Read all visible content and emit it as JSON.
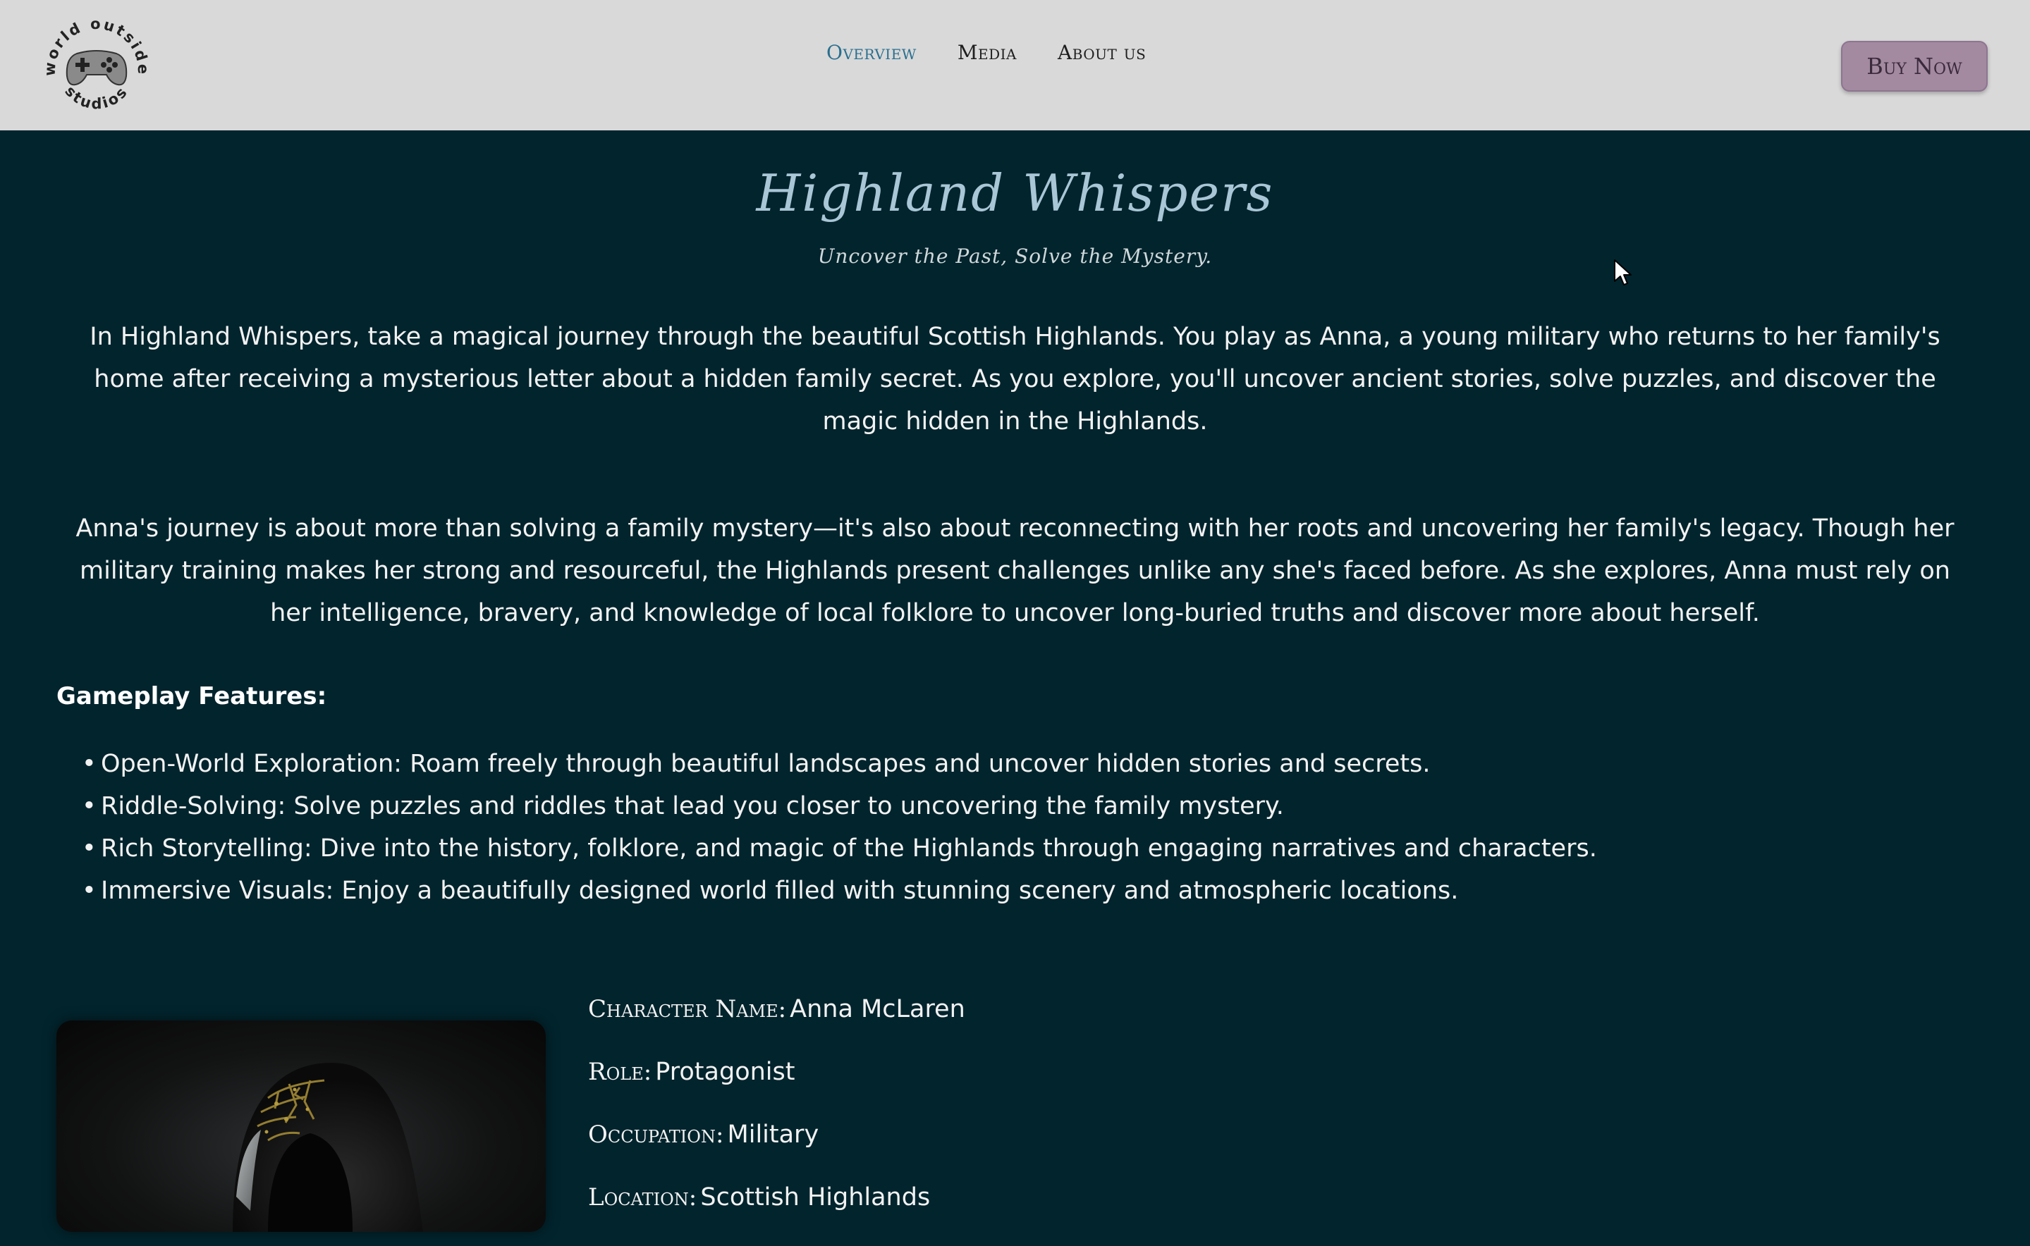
{
  "header": {
    "logo": {
      "top_text": "world outside",
      "bottom_text": "studios",
      "icon": "gamepad-icon"
    },
    "nav": [
      {
        "label": "Overview",
        "active": true
      },
      {
        "label": "Media",
        "active": false
      },
      {
        "label": "About us",
        "active": false
      }
    ],
    "buy_button_label": "Buy Now"
  },
  "hero": {
    "title": "Highland Whispers",
    "tagline": "Uncover the Past, Solve the Mystery."
  },
  "description": {
    "paragraph1": "In Highland Whispers, take a magical journey through the beautiful Scottish Highlands. You play as Anna, a young military who returns to her family's home after receiving a mysterious letter about a hidden family secret. As you explore, you'll uncover ancient stories, solve puzzles, and discover the magic hidden in the Highlands.",
    "paragraph2": "Anna's journey is about more than solving a family mystery—it's also about reconnecting with her roots and uncovering her family's legacy. Though her military training makes her strong and resourceful, the Highlands present challenges unlike any she's faced before. As she explores, Anna must rely on her intelligence, bravery, and knowledge of local folklore to uncover long-buried truths and discover more about herself."
  },
  "features": {
    "heading": "Gameplay Features:",
    "items": [
      "Open-World Exploration: Roam freely through beautiful landscapes and uncover hidden stories and secrets.",
      "Riddle-Solving: Solve puzzles and riddles that lead you closer to uncovering the family mystery.",
      "Rich Storytelling: Dive into the history, folklore, and magic of the Highlands through engaging narratives and characters.",
      "Immersive Visuals: Enjoy a beautifully designed world filled with stunning scenery and atmospheric locations."
    ]
  },
  "character": {
    "rows": [
      {
        "key": "Character Name:",
        "value": "Anna McLaren"
      },
      {
        "key": "Role:",
        "value": "Protagonist"
      },
      {
        "key": "Occupation:",
        "value": "Military"
      },
      {
        "key": "Location:",
        "value": "Scottish Highlands"
      }
    ]
  },
  "colors": {
    "page_background": "#02242d",
    "header_background": "#d9d9d9",
    "title": "#a9c6d6",
    "active_nav": "#2a6f8f",
    "buy_button": "#a38aa1"
  }
}
